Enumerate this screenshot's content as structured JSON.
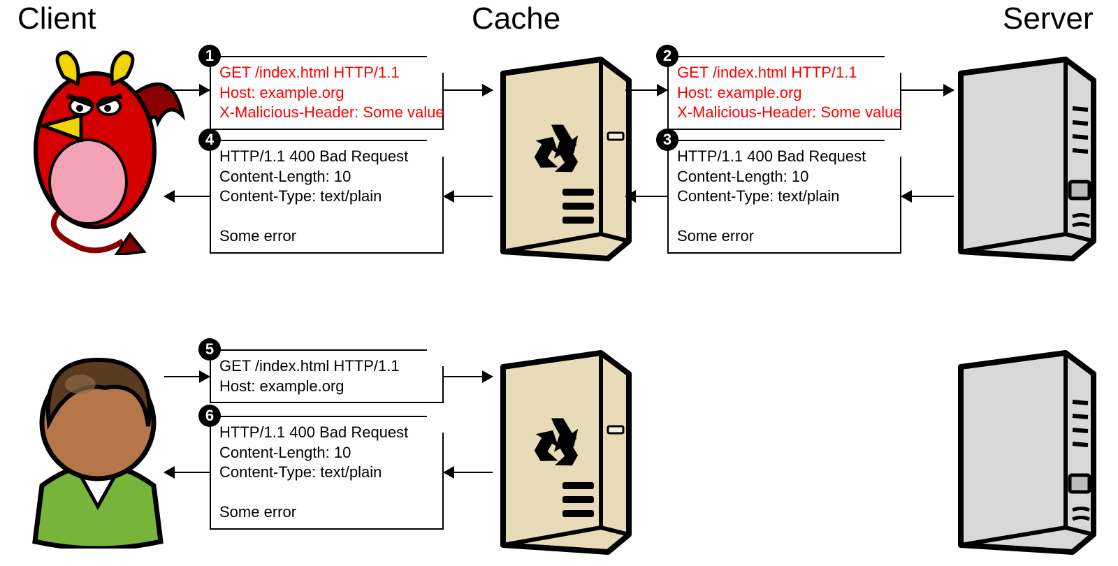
{
  "headers": {
    "client": "Client",
    "cache": "Cache",
    "server": "Server"
  },
  "messages": {
    "m1": {
      "num": "1",
      "lines": [
        "GET /index.html HTTP/1.1",
        "Host: example.org",
        "X-Malicious-Header: Some value"
      ],
      "red": true
    },
    "m2": {
      "num": "2",
      "lines": [
        "GET /index.html HTTP/1.1",
        "Host: example.org",
        "X-Malicious-Header: Some value"
      ],
      "red": true
    },
    "m3": {
      "num": "3",
      "lines": [
        "HTTP/1.1 400 Bad Request",
        "Content-Length: 10",
        "Content-Type: text/plain",
        "",
        "Some error"
      ]
    },
    "m4": {
      "num": "4",
      "lines": [
        "HTTP/1.1 400 Bad Request",
        "Content-Length: 10",
        "Content-Type: text/plain",
        "",
        "Some error"
      ]
    },
    "m5": {
      "num": "5",
      "lines": [
        "GET /index.html HTTP/1.1",
        "Host: example.org"
      ]
    },
    "m6": {
      "num": "6",
      "lines": [
        "HTTP/1.1 400 Bad Request",
        "Content-Length: 10",
        "Content-Type: text/plain",
        "",
        "Some error"
      ]
    }
  }
}
